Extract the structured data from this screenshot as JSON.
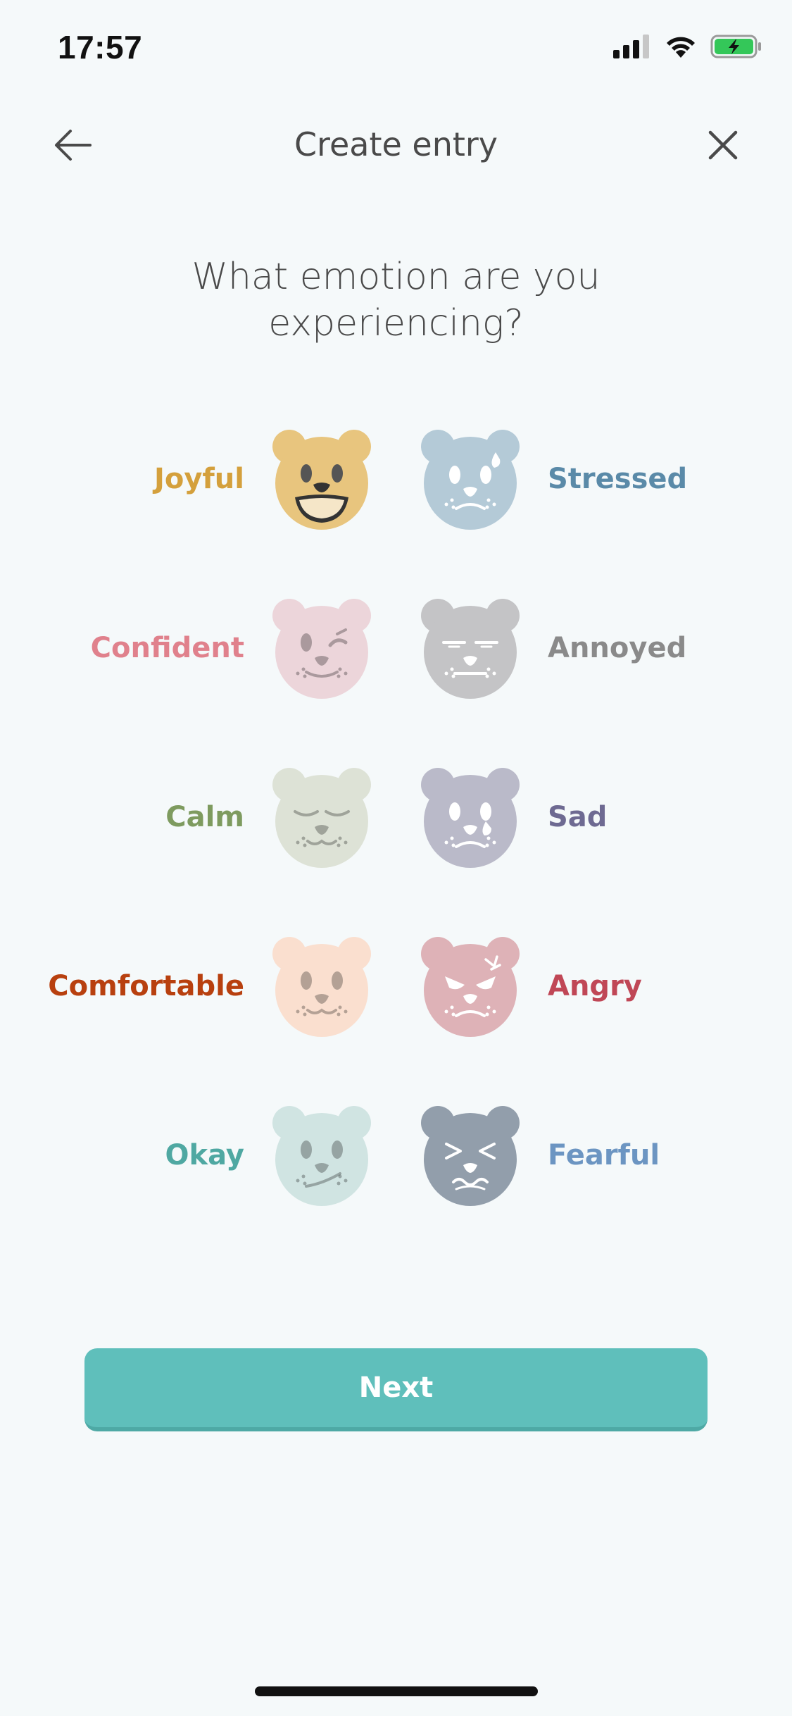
{
  "status": {
    "time": "17:57",
    "icons": [
      "signal-icon",
      "wifi-icon",
      "battery-charging-icon"
    ]
  },
  "header": {
    "title": "Create entry",
    "back_icon": "arrow-left-icon",
    "close_icon": "close-icon"
  },
  "question": "What emotion are you experiencing?",
  "emotions": {
    "left": [
      {
        "label": "Joyful",
        "color": "#d4a03c",
        "bear": "#e8c57e",
        "face": "joyful"
      },
      {
        "label": "Confident",
        "color": "#e0818c",
        "bear": "#ecd5da",
        "face": "wink"
      },
      {
        "label": "Calm",
        "color": "#7e9b5f",
        "bear": "#dde2d6",
        "face": "calm"
      },
      {
        "label": "Comfortable",
        "color": "#b8400f",
        "bear": "#fadfcf",
        "face": "neutral"
      },
      {
        "label": "Okay",
        "color": "#4fa8a2",
        "bear": "#d0e4e2",
        "face": "okay"
      }
    ],
    "right": [
      {
        "label": "Stressed",
        "color": "#5a8aa8",
        "bear": "#b4cad7",
        "face": "stressed"
      },
      {
        "label": "Annoyed",
        "color": "#8a8a8a",
        "bear": "#c4c4c6",
        "face": "annoyed"
      },
      {
        "label": "Sad",
        "color": "#6e6a92",
        "bear": "#babac9",
        "face": "sad"
      },
      {
        "label": "Angry",
        "color": "#c04756",
        "bear": "#deb2b7",
        "face": "angry"
      },
      {
        "label": "Fearful",
        "color": "#6c95c2",
        "bear": "#929eab",
        "face": "fearful"
      }
    ]
  },
  "next_button": {
    "label": "Next",
    "color": "#5fbfbb"
  }
}
